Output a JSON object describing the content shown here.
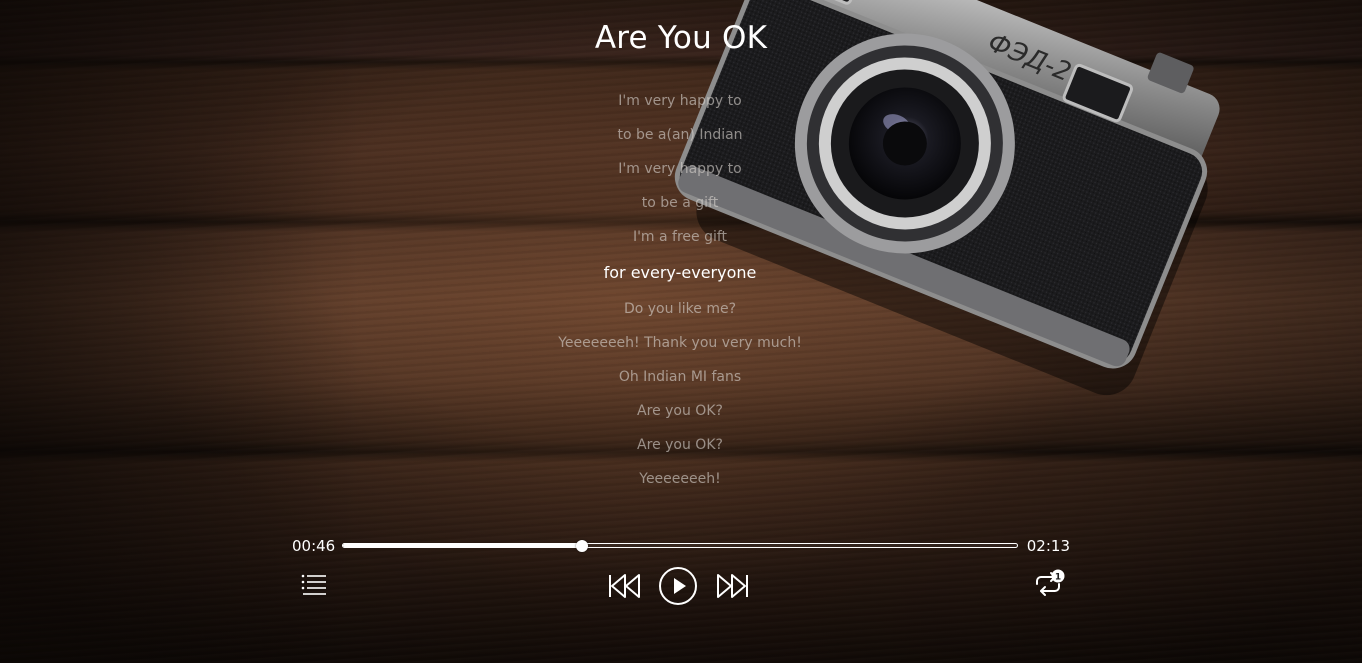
{
  "player": {
    "title": "Are You OK",
    "lyrics": [
      "I'm very happy to",
      "to be a(an) Indian",
      "I'm very happy to",
      "to be a gift",
      "I'm a free gift",
      "for every-everyone",
      "Do you like me?",
      "Yeeeeeeeh! Thank you very much!",
      "Oh Indian MI fans",
      "Are you OK?",
      "Are you OK?",
      "Yeeeeeeeh!"
    ],
    "active_lyric_index": 5,
    "current_time": "00:46",
    "total_time": "02:13",
    "progress_percent": 35.4,
    "repeat_badge": "1"
  },
  "icons": {
    "playlist": "playlist-icon",
    "previous": "previous-icon",
    "play": "play-icon",
    "next": "next-icon",
    "repeat": "repeat-one-icon"
  },
  "colors": {
    "text_active": "#ffffff",
    "text_inactive": "#d7d2cd",
    "accent": "#ffffff"
  }
}
